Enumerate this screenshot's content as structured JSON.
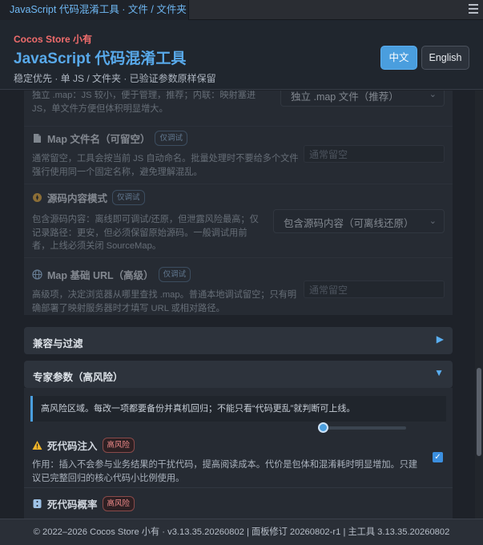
{
  "titlebar": {
    "tab_title": "JavaScript 代码混淆工具 · 文件 / 文件夹"
  },
  "header": {
    "brand": "Cocos Store 小有",
    "title": "JavaScript 代码混淆工具",
    "subtitle": "稳定优先 · 单 JS / 文件夹 · 已验证参数原样保留",
    "lang_zh": "中文",
    "lang_en": "English"
  },
  "sourcemap": {
    "mode_desc": "独立 .map：JS 较小，便于管理，推荐；内联：映射塞进 JS，单文件方便但体积明显增大。",
    "mode_select_value": "独立 .map 文件（推荐）",
    "filename_title": "Map 文件名（可留空）",
    "filename_badge": "仅调试",
    "filename_desc": "通常留空，工具会按当前 JS 自动命名。批量处理时不要给多个文件强行使用同一个固定名称，避免理解混乱。",
    "filename_placeholder": "通常留空",
    "content_title": "源码内容模式",
    "content_badge": "仅调试",
    "content_desc": "包含源码内容：离线即可调试/还原，但泄露风险最高；仅记录路径：更安，但必须保留原始源码。一般调试用前者，上线必须关闭 SourceMap。",
    "content_select_value": "包含源码内容（可离线还原）",
    "baseurl_title": "Map 基础 URL（高级）",
    "baseurl_badge": "仅调试",
    "baseurl_desc": "高级项，决定浏览器从哪里查找 .map。普通本地调试留空；只有明确部署了映射服务器时才填写 URL 或相对路径。",
    "baseurl_placeholder": "通常留空"
  },
  "sections": {
    "compat_title": "兼容与过滤",
    "compat_arrow": "▶",
    "expert_title": "专家参数（高风险）",
    "expert_arrow": "▼"
  },
  "expert": {
    "alert": "高风险区域。每改一项都要备份并真机回归；不能只看“代码更乱”就判断可上线。",
    "deadcode_title": "死代码注入",
    "deadcode_badge": "高风险",
    "deadcode_desc": "作用：插入不会参与业务结果的干扰代码，提高阅读成本。代价是包体和混淆耗时明显增加。只建议已完整回归的核心代码小比例使用。",
    "deadcode_checked": true,
    "deadcode_check_glyph": "✓",
    "threshold_title": "死代码概率",
    "threshold_badge": "高风险",
    "threshold_value": 0.05
  },
  "footer": {
    "text": "© 2022–2026 Cocos Store 小有 · v3.13.35.20260802 | 面板修订 20260802-r1 | 主工具 3.13.35.20260802"
  },
  "colors": {
    "accent": "#4a9ede",
    "brand_red": "#f06c6c",
    "title_blue": "#58a9ea",
    "warning": "#f0b429"
  },
  "icons": {
    "filename": "file-icon",
    "content": "compass-icon",
    "baseurl": "globe-icon",
    "deadcode": "warning-icon",
    "threshold": "dice-icon"
  }
}
